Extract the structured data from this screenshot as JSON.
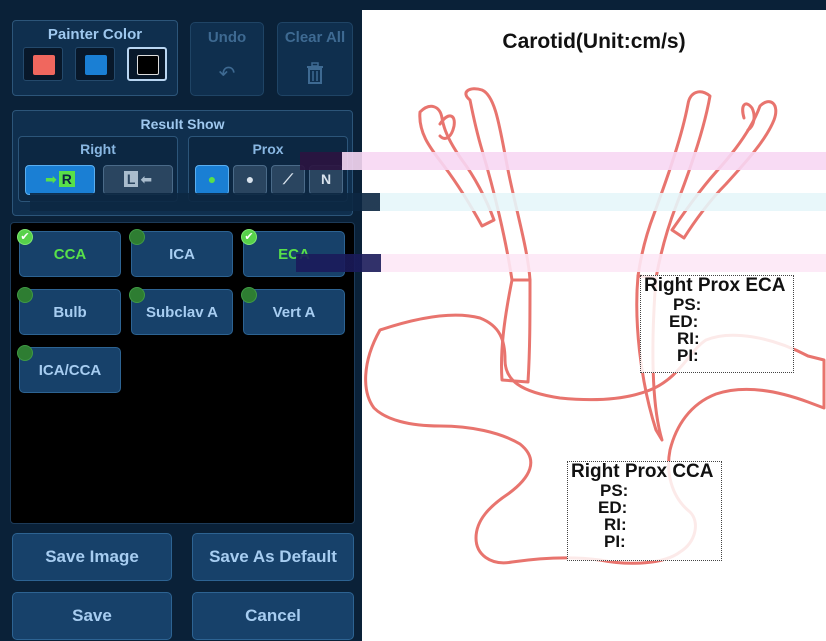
{
  "painter_color": {
    "title": "Painter Color",
    "swatches": [
      {
        "color": "#f0675e",
        "selected": false
      },
      {
        "color": "#1a7fd4",
        "selected": false
      },
      {
        "color": "#000000",
        "selected": true
      }
    ],
    "undo_label": "Undo",
    "clear_all_label": "Clear All"
  },
  "result_show": {
    "title": "Result Show",
    "side": {
      "title": "Right",
      "options": [
        "R",
        "L"
      ]
    },
    "position": {
      "title": "Prox",
      "options": [
        "N"
      ]
    }
  },
  "vessels": [
    {
      "label": "CCA",
      "checked": true
    },
    {
      "label": "ICA",
      "checked": false
    },
    {
      "label": "ECA",
      "checked": true
    },
    {
      "label": "Bulb",
      "checked": false
    },
    {
      "label": "Subclav A",
      "checked": false
    },
    {
      "label": "Vert A",
      "checked": false
    },
    {
      "label": "ICA/CCA",
      "checked": false
    }
  ],
  "buttons": {
    "save_image": "Save Image",
    "save_as_default": "Save As Default",
    "save": "Save",
    "cancel": "Cancel"
  },
  "diagram": {
    "title": "Carotid(Unit:cm/s)",
    "vessel_color": "#e8746e",
    "results": [
      {
        "title": "Right Prox ECA",
        "ps": "PS:",
        "ed": "ED:",
        "ri": "RI:",
        "pi": "PI:"
      },
      {
        "title": "Right Prox CCA",
        "ps": "PS:",
        "ed": "ED:",
        "ri": "RI:",
        "pi": "PI:"
      }
    ]
  },
  "icons": {
    "undo": "undo-icon",
    "clear_all": "trash-icon",
    "checkmark": "check-icon"
  }
}
